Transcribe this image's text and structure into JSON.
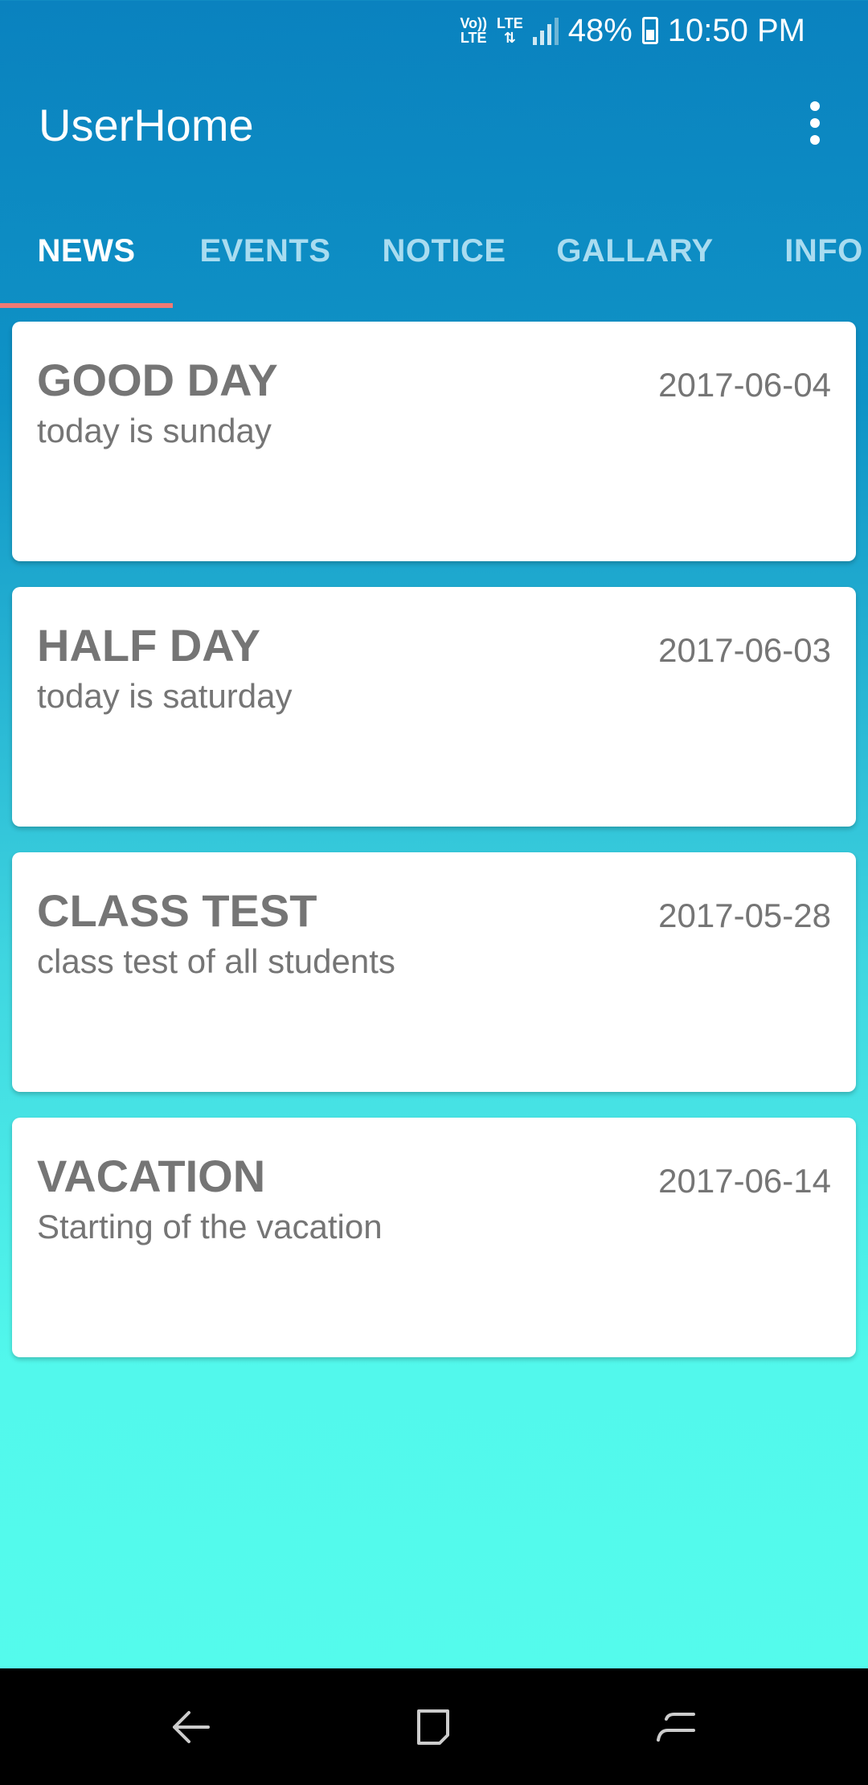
{
  "status_bar": {
    "volte": "Vo)) LTE",
    "lte": "LTE",
    "battery_percent": "48%",
    "time": "10:50 PM",
    "icons": [
      "volte-icon",
      "lte-data-icon",
      "signal-icon",
      "battery-charging-icon"
    ]
  },
  "app_bar": {
    "title": "UserHome",
    "menu_icon": "more-vert-icon"
  },
  "tabs": [
    {
      "label": "NEWS",
      "active": true
    },
    {
      "label": "EVENTS",
      "active": false
    },
    {
      "label": "NOTICE",
      "active": false
    },
    {
      "label": "GALLARY",
      "active": false
    },
    {
      "label": "INFO",
      "active": false
    }
  ],
  "news": [
    {
      "title": "GOOD DAY",
      "date": "2017-06-04",
      "description": "today is sunday"
    },
    {
      "title": "HALF DAY",
      "date": "2017-06-03",
      "description": "today is saturday"
    },
    {
      "title": "CLASS TEST",
      "date": "2017-05-28",
      "description": "class test of all students"
    },
    {
      "title": "VACATION",
      "date": "2017-06-14",
      "description": "Starting of the vacation"
    }
  ],
  "nav_bar": {
    "icons": [
      "back-icon",
      "home-icon",
      "recents-icon"
    ]
  },
  "colors": {
    "app_bar": "#0a82bf",
    "tab_indicator": "#f07a74",
    "background_bottom": "#54fbec",
    "card_text": "#757575"
  }
}
